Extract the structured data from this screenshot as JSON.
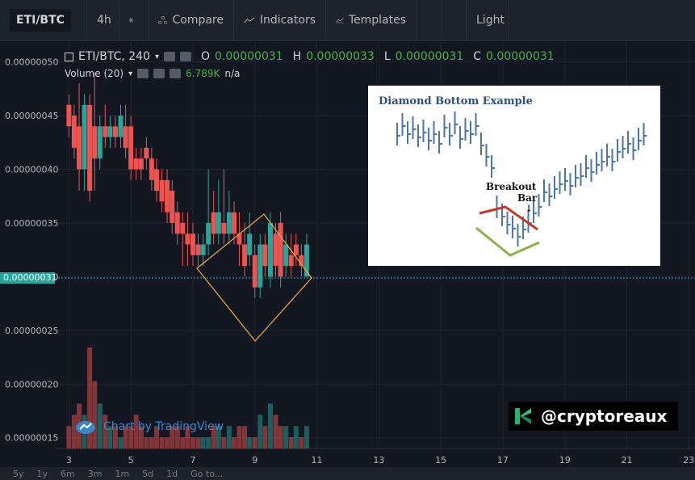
{
  "toolbar": {
    "symbol": "ETI/BTC",
    "interval": "4h",
    "compare": "Compare",
    "indicators": "Indicators",
    "templates": "Templates",
    "theme": "Light"
  },
  "legend": {
    "title": "ETI/BTC, 240",
    "o_label": "O",
    "o_value": "0.00000031",
    "h_label": "H",
    "h_value": "0.00000033",
    "l_label": "L",
    "l_value": "0.00000031",
    "c_label": "C",
    "c_value": "0.00000031"
  },
  "volume_legend": {
    "label": "Volume (20)",
    "value": "6.789K",
    "na": "n/a"
  },
  "current_price": "0.00000031",
  "inset": {
    "title": "Diamond Bottom Example",
    "breakout": "Breakout",
    "bar": "Bar",
    "arrow": "↓"
  },
  "brand": {
    "handle": "@cryptoreaux"
  },
  "tv_badge": {
    "text": "Chart by TradingView"
  },
  "bottombar": {
    "ranges": [
      "5y",
      "1y",
      "6m",
      "3m",
      "1m",
      "5d",
      "1d",
      "Go to..."
    ]
  },
  "colors": {
    "up": "#26a69a",
    "down": "#ef5350",
    "diamond": "#e8a33b",
    "bg": "#131722",
    "grid": "#1f2433"
  },
  "chart_data": {
    "type": "candlestick",
    "x_ticks": [
      "3",
      "5",
      "7",
      "9",
      "11",
      "13",
      "15",
      "17",
      "19",
      "21",
      "23"
    ],
    "y_ticks": [
      "0.00000050",
      "0.00000045",
      "0.00000040",
      "0.00000035",
      "0.00000030",
      "0.00000025",
      "0.00000020",
      "0.00000015"
    ],
    "ylim": [
      1.4e-07,
      5.2e-07
    ],
    "xlim": [
      2.6,
      23.2
    ],
    "candles": [
      {
        "x": 3.0,
        "o": 46,
        "c": 44,
        "h": 47,
        "l": 43
      },
      {
        "x": 3.17,
        "o": 45,
        "c": 42,
        "h": 46,
        "l": 41
      },
      {
        "x": 3.33,
        "o": 44,
        "c": 40,
        "h": 48,
        "l": 38
      },
      {
        "x": 3.5,
        "o": 40,
        "c": 46,
        "h": 47,
        "l": 38
      },
      {
        "x": 3.67,
        "o": 46,
        "c": 38,
        "h": 47,
        "l": 37
      },
      {
        "x": 3.83,
        "o": 44,
        "c": 41,
        "h": 49,
        "l": 38
      },
      {
        "x": 4.0,
        "o": 41,
        "c": 44,
        "h": 45,
        "l": 40
      },
      {
        "x": 4.17,
        "o": 44,
        "c": 43,
        "h": 46,
        "l": 42
      },
      {
        "x": 4.33,
        "o": 43,
        "c": 44,
        "h": 45,
        "l": 42
      },
      {
        "x": 4.5,
        "o": 44,
        "c": 43,
        "h": 45,
        "l": 42
      },
      {
        "x": 4.67,
        "o": 43,
        "c": 45,
        "h": 46,
        "l": 42
      },
      {
        "x": 4.83,
        "o": 44,
        "c": 42,
        "h": 46,
        "l": 41
      },
      {
        "x": 5.0,
        "o": 44,
        "c": 40,
        "h": 45,
        "l": 39
      },
      {
        "x": 5.17,
        "o": 41,
        "c": 40,
        "h": 42,
        "l": 39
      },
      {
        "x": 5.33,
        "o": 41,
        "c": 40,
        "h": 42,
        "l": 39
      },
      {
        "x": 5.5,
        "o": 42,
        "c": 41,
        "h": 43,
        "l": 40
      },
      {
        "x": 5.67,
        "o": 41,
        "c": 39,
        "h": 42,
        "l": 38
      },
      {
        "x": 5.83,
        "o": 40,
        "c": 38,
        "h": 41,
        "l": 37
      },
      {
        "x": 6.0,
        "o": 39,
        "c": 37,
        "h": 40,
        "l": 36
      },
      {
        "x": 6.17,
        "o": 39,
        "c": 36,
        "h": 40,
        "l": 35
      },
      {
        "x": 6.33,
        "o": 38,
        "c": 35,
        "h": 39,
        "l": 34
      },
      {
        "x": 6.5,
        "o": 36,
        "c": 34,
        "h": 37,
        "l": 33
      },
      {
        "x": 6.67,
        "o": 35,
        "c": 34,
        "h": 36,
        "l": 31
      },
      {
        "x": 6.83,
        "o": 34,
        "c": 33,
        "h": 36,
        "l": 31
      },
      {
        "x": 7.0,
        "o": 34,
        "c": 32,
        "h": 35,
        "l": 31
      },
      {
        "x": 7.17,
        "o": 33,
        "c": 32,
        "h": 34,
        "l": 31
      },
      {
        "x": 7.33,
        "o": 32,
        "c": 33,
        "h": 34,
        "l": 31
      },
      {
        "x": 7.5,
        "o": 33,
        "c": 35,
        "h": 40,
        "l": 32
      },
      {
        "x": 7.67,
        "o": 36,
        "c": 34,
        "h": 38,
        "l": 33
      },
      {
        "x": 7.83,
        "o": 34,
        "c": 36,
        "h": 39,
        "l": 33
      },
      {
        "x": 8.0,
        "o": 35,
        "c": 34,
        "h": 40,
        "l": 33
      },
      {
        "x": 8.17,
        "o": 34,
        "c": 36,
        "h": 38,
        "l": 33
      },
      {
        "x": 8.33,
        "o": 36,
        "c": 34,
        "h": 37,
        "l": 33
      },
      {
        "x": 8.5,
        "o": 34,
        "c": 33,
        "h": 36,
        "l": 31
      },
      {
        "x": 8.67,
        "o": 33,
        "c": 31,
        "h": 35,
        "l": 30
      },
      {
        "x": 8.83,
        "o": 32,
        "c": 34,
        "h": 36,
        "l": 31
      },
      {
        "x": 9.0,
        "o": 32,
        "c": 29,
        "h": 33,
        "l": 28
      },
      {
        "x": 9.17,
        "o": 29,
        "c": 33,
        "h": 34,
        "l": 28
      },
      {
        "x": 9.33,
        "o": 33,
        "c": 31,
        "h": 34,
        "l": 30
      },
      {
        "x": 9.5,
        "o": 30,
        "c": 35,
        "h": 36,
        "l": 29
      },
      {
        "x": 9.67,
        "o": 34,
        "c": 31,
        "h": 35,
        "l": 30
      },
      {
        "x": 9.83,
        "o": 35,
        "c": 30,
        "h": 36,
        "l": 29
      },
      {
        "x": 10.0,
        "o": 31,
        "c": 33,
        "h": 34,
        "l": 30
      },
      {
        "x": 10.17,
        "o": 32,
        "c": 31,
        "h": 34,
        "l": 30
      },
      {
        "x": 10.33,
        "o": 33,
        "c": 32,
        "h": 34,
        "l": 31
      },
      {
        "x": 10.5,
        "o": 32,
        "c": 31,
        "h": 33,
        "l": 30
      },
      {
        "x": 10.67,
        "o": 30,
        "c": 33,
        "h": 34,
        "l": 30
      }
    ],
    "volume": [
      2,
      3,
      4,
      3,
      9,
      6,
      4,
      3,
      2,
      2,
      1,
      2,
      2,
      3,
      2,
      1,
      1,
      2,
      1,
      1,
      2,
      2,
      1,
      2,
      1,
      1,
      1,
      1,
      2,
      2,
      1,
      2,
      1,
      2,
      2,
      1,
      1,
      3,
      2,
      4,
      3,
      2,
      2,
      1,
      2,
      1,
      2
    ],
    "volume_up": [
      false,
      false,
      false,
      true,
      false,
      false,
      true,
      false,
      true,
      false,
      true,
      false,
      false,
      false,
      false,
      false,
      false,
      false,
      false,
      false,
      false,
      false,
      false,
      false,
      false,
      false,
      true,
      true,
      false,
      true,
      false,
      true,
      false,
      false,
      false,
      true,
      false,
      true,
      false,
      true,
      false,
      false,
      true,
      false,
      true,
      false,
      true
    ]
  }
}
